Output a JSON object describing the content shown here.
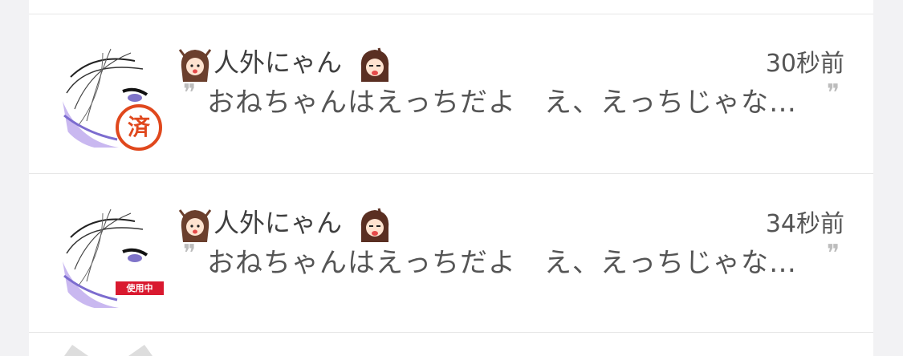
{
  "rows": [
    {
      "name": "人外にゃん",
      "time": "30秒前",
      "message": "おねちゃんはえっちだよ　え、えっちじゃな…",
      "badge": {
        "type": "stamp",
        "label": "済",
        "color": "#e0481d"
      },
      "left_emoji": "girl-face-icon",
      "right_emoji": "girl-crying-icon"
    },
    {
      "name": "人外にゃん",
      "time": "34秒前",
      "message": "おねちゃんはえっちだよ　え、えっちじゃな…",
      "badge": {
        "type": "label",
        "label": "使用中",
        "color": "#d9192f"
      },
      "left_emoji": "girl-face-icon",
      "right_emoji": "girl-crying-icon"
    }
  ],
  "quote_open": "❞",
  "quote_close": "❞"
}
